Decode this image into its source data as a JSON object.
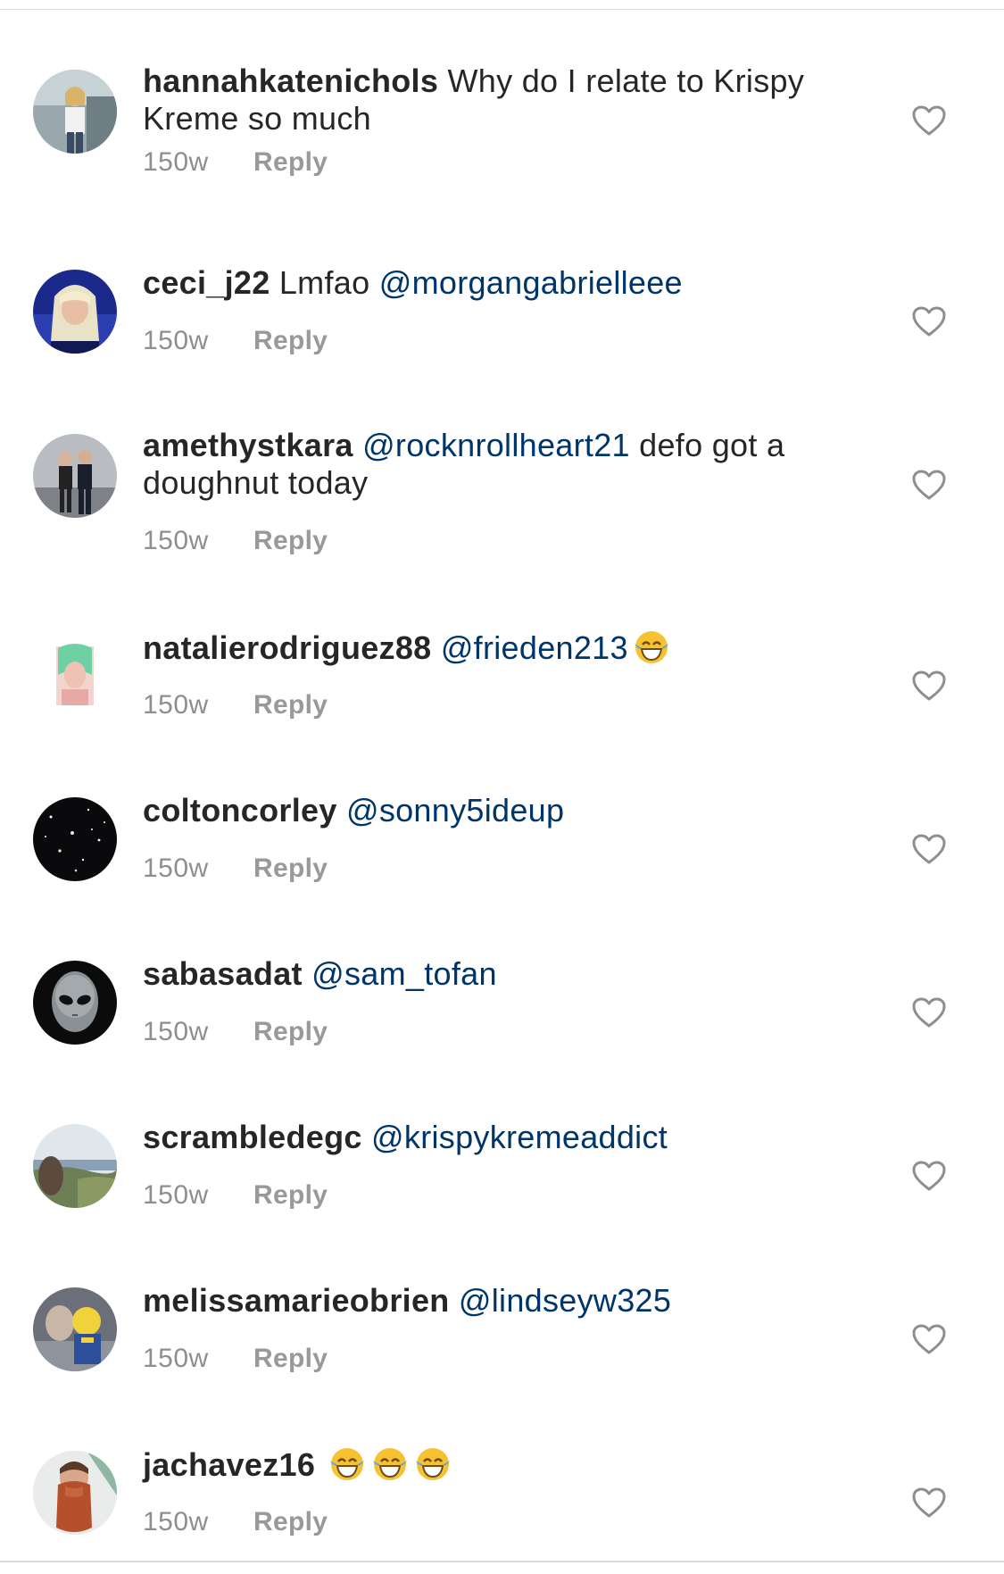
{
  "comments": [
    {
      "username": "hannahkatenichols",
      "text": "Why do I relate to Krispy Kreme so much",
      "mention": "",
      "emoji_count": 0,
      "age": "150w",
      "reply_label": "Reply"
    },
    {
      "username": "ceci_j22",
      "text": "Lmfao",
      "mention": "@morgangabrielleee",
      "emoji_count": 0,
      "age": "150w",
      "reply_label": "Reply"
    },
    {
      "username": "amethystkara",
      "mention": "@rocknrollheart21",
      "text_after": "defo got a doughnut today",
      "emoji_count": 0,
      "age": "150w",
      "reply_label": "Reply"
    },
    {
      "username": "natalierodriguez88",
      "mention": "@frieden213",
      "emoji_count": 1,
      "age": "150w",
      "reply_label": "Reply"
    },
    {
      "username": "coltoncorley",
      "mention": "@sonny5ideup",
      "emoji_count": 0,
      "age": "150w",
      "reply_label": "Reply"
    },
    {
      "username": "sabasadat",
      "mention": "@sam_tofan",
      "emoji_count": 0,
      "age": "150w",
      "reply_label": "Reply"
    },
    {
      "username": "scrambledegc",
      "mention": "@krispykremeaddict",
      "emoji_count": 0,
      "age": "150w",
      "reply_label": "Reply"
    },
    {
      "username": "melissamarieobrien",
      "mention": "@lindseyw325",
      "emoji_count": 0,
      "age": "150w",
      "reply_label": "Reply"
    },
    {
      "username": "jachavez16",
      "mention": "",
      "emoji_count": 3,
      "age": "150w",
      "reply_label": "Reply"
    }
  ],
  "icons": {
    "like": "heart-outline-icon",
    "emoji": "face-with-tears-of-joy-emoji"
  },
  "colors": {
    "username": "#262626",
    "mention": "#003569",
    "meta": "#8e8e8e",
    "reply": "#999999",
    "heart_stroke": "#8e8e8e"
  }
}
